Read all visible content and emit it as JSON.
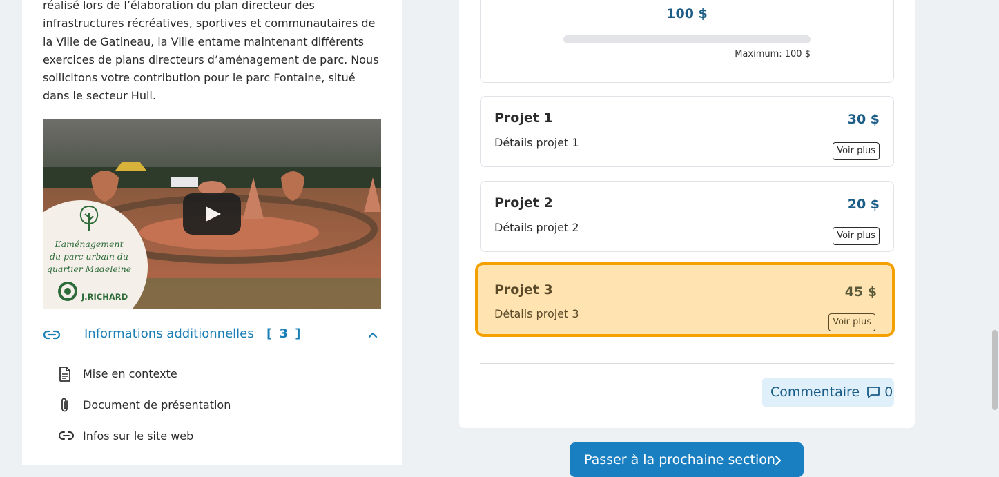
{
  "intro": {
    "text": "réalisé lors de l’élaboration du plan directeur des infrastructures récréatives, sportives et communautaires de la Ville de Gatineau, la Ville entame maintenant différents exercices de plans directeurs d’aménagement de parc. Nous sollicitons votre contribution pour le parc Fontaine, situé dans le secteur Hull."
  },
  "video": {
    "overlay_text_line1": "L’aménagement",
    "overlay_text_line2": "du parc urbain du",
    "overlay_text_line3": "quartier Madeleine",
    "logo_text": "J.RICHARD",
    "icon": "play-icon"
  },
  "additional_info": {
    "title": "Informations additionnelles",
    "count": "[ 3 ]",
    "items": [
      {
        "label": "Mise en contexte",
        "icon": "document-icon"
      },
      {
        "label": "Document de présentation",
        "icon": "paperclip-icon"
      },
      {
        "label": "Infos sur le site web",
        "icon": "link-icon"
      }
    ]
  },
  "budget": {
    "total": "100 $",
    "maximum": "Maximum: 100 $",
    "progress_fraction": 0
  },
  "projects": [
    {
      "name": "Projet 1",
      "details": "Détails projet 1",
      "amount": "30 $",
      "button": "Voir plus",
      "selected": false
    },
    {
      "name": "Projet 2",
      "details": "Détails projet 2",
      "amount": "20 $",
      "button": "Voir plus",
      "selected": false
    },
    {
      "name": "Projet 3",
      "details": "Détails projet 3",
      "amount": "45 $",
      "button": "Voir plus",
      "selected": true
    }
  ],
  "comment": {
    "label": "Commentaire",
    "count": "0"
  },
  "next_section": {
    "label": "Passer à la prochaine section"
  },
  "colors": {
    "accent": "#1a7fc1",
    "selected_border": "#f4a100",
    "selected_bg": "#ffe3b0",
    "amount": "#1c5d87"
  }
}
